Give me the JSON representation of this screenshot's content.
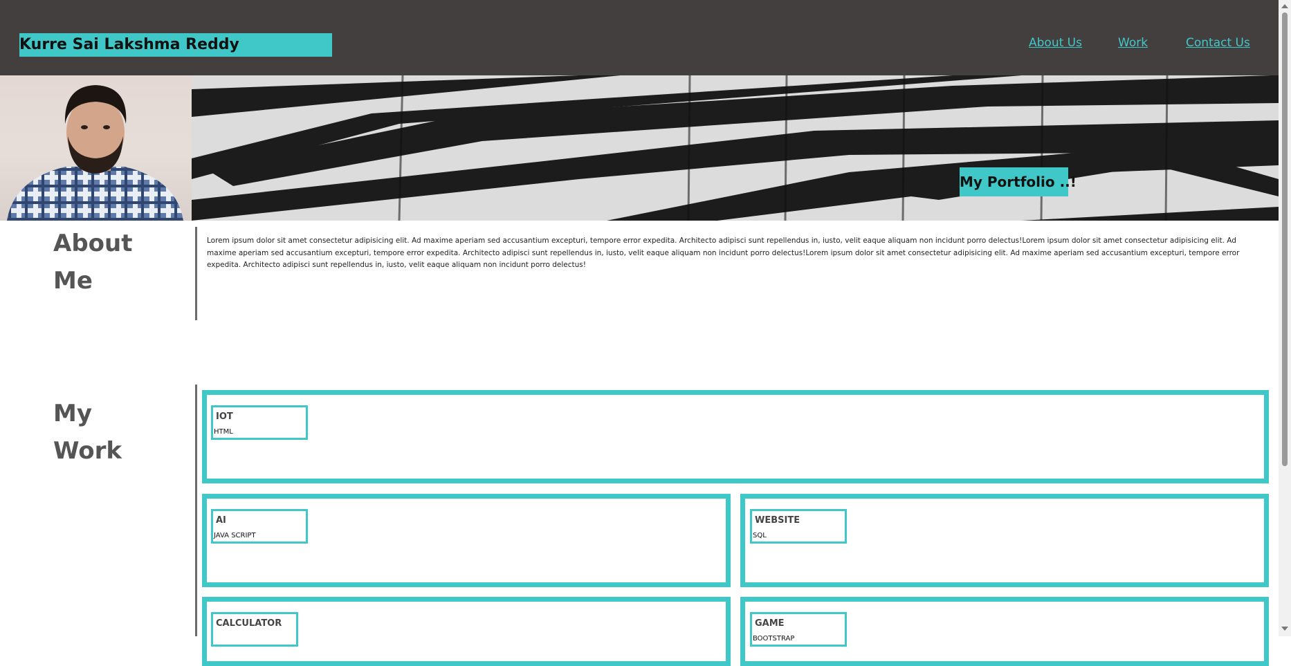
{
  "header": {
    "brand": "Kurre Sai Lakshma Reddy",
    "nav": [
      {
        "label": "About Us"
      },
      {
        "label": "Work"
      },
      {
        "label": "Contact Us"
      }
    ]
  },
  "banner": {
    "portfolio_label": "My Portfolio ..!"
  },
  "about": {
    "title_line1": "About",
    "title_line2": "Me",
    "text": "Lorem ipsum dolor sit amet consectetur adipisicing elit. Ad maxime aperiam sed accusantium excepturi, tempore error expedita. Architecto adipisci sunt repellendus in, iusto, velit eaque aliquam non incidunt porro delectus!Lorem ipsum dolor sit amet consectetur adipisicing elit. Ad maxime aperiam sed accusantium excepturi, tempore error expedita. Architecto adipisci sunt repellendus in, iusto, velit eaque aliquam non incidunt porro delectus!Lorem ipsum dolor sit amet consectetur adipisicing elit. Ad maxime aperiam sed accusantium excepturi, tempore error expedita. Architecto adipisci sunt repellendus in, iusto, velit eaque aliquam non incidunt porro delectus!"
  },
  "work": {
    "title_line1": "My",
    "title_line2": "Work",
    "projects": [
      {
        "title": "IOT",
        "tech": "HTML"
      },
      {
        "title": "AI",
        "tech": "JAVA SCRIPT"
      },
      {
        "title": "WEBSITE",
        "tech": "SQL"
      },
      {
        "title": "CALCULATOR",
        "tech": ""
      },
      {
        "title": "GAME",
        "tech": "BOOTSTRAP"
      }
    ]
  },
  "colors": {
    "header_bg": "#433f3e",
    "accent": "#40c8c8",
    "heading_text": "#555555"
  }
}
